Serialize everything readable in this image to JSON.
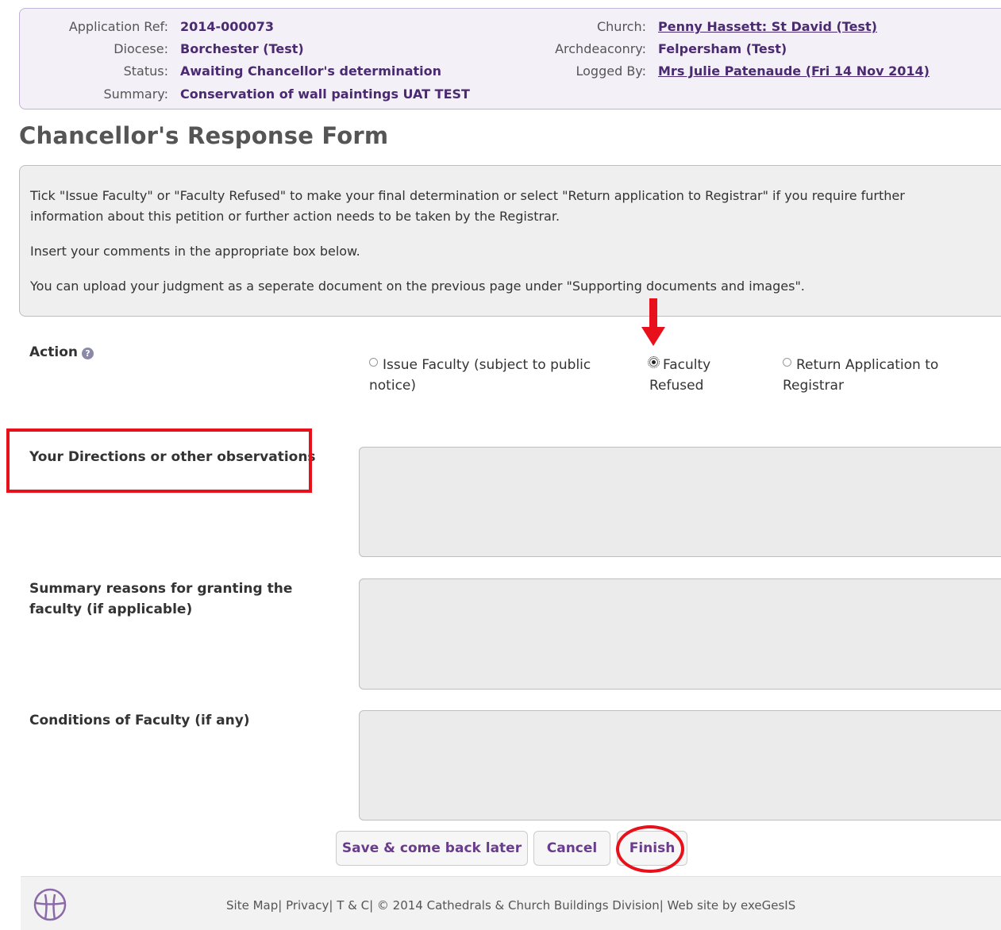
{
  "summary": {
    "app_ref_label": "Application Ref:",
    "app_ref_value": "2014-000073",
    "diocese_label": "Diocese:",
    "diocese_value": "Borchester (Test)",
    "status_label": "Status:",
    "status_value": "Awaiting Chancellor's determination",
    "summary_label": "Summary:",
    "summary_value": "Conservation of wall paintings UAT TEST",
    "church_label": "Church:",
    "church_value": "Penny Hassett: St David (Test)",
    "archdeaconry_label": "Archdeaconry:",
    "archdeaconry_value": "Felpersham (Test)",
    "logged_by_label": "Logged By:",
    "logged_by_value": "Mrs Julie Patenaude (Fri 14 Nov 2014)"
  },
  "page_title": "Chancellor's Response Form",
  "instructions": {
    "p1": "Tick \"Issue Faculty\" or \"Faculty Refused\" to make your final determination or select \"Return application to Registrar\" if you require further information about this petition or further action needs to be taken by the Registrar.",
    "p2": "Insert your comments in the appropriate box below.",
    "p3": "You can upload your judgment as a seperate document on the previous page under \"Supporting documents and images\"."
  },
  "action": {
    "label": "Action",
    "help_icon": "question-icon",
    "options": [
      {
        "label": "Issue Faculty (subject to public notice)",
        "checked": false
      },
      {
        "label": "Faculty Refused",
        "checked": true
      },
      {
        "label": "Return Application to Registrar",
        "checked": false
      }
    ]
  },
  "fields": {
    "directions_label": "Your Directions or other observations",
    "reasons_label": "Summary reasons for granting the faculty (if applicable)",
    "conditions_label": "Conditions of Faculty (if any)"
  },
  "buttons": {
    "save_label": "Save & come back later",
    "cancel_label": "Cancel",
    "finish_label": "Finish"
  },
  "footer": {
    "logo_icon": "church-cross-icon",
    "site_map": "Site Map",
    "privacy": "Privacy",
    "tc": "T & C",
    "copyright": "© 2014 Cathedrals & Church Buildings Division",
    "credit": "Web site by exeGesIS"
  },
  "colors": {
    "annotation_red": "#e8101a",
    "accent_purple": "#4a2a70"
  }
}
